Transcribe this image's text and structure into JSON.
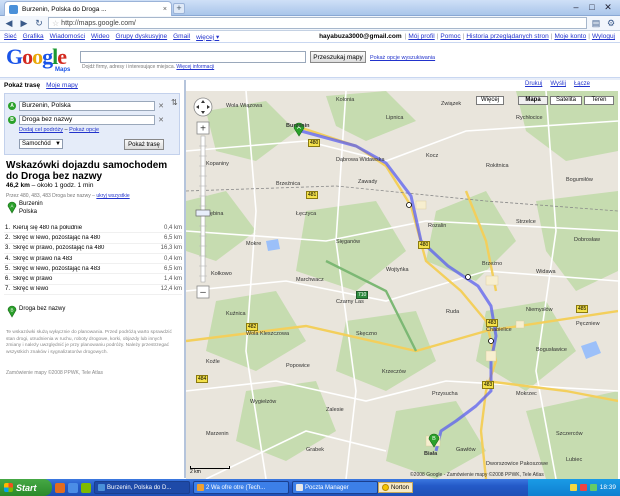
{
  "browser": {
    "tab_title": "Burzenin, Polska do Droga ...",
    "url": "http://maps.google.com/"
  },
  "gbar": {
    "links": [
      "Sieć",
      "Grafika",
      "Wiadomości",
      "Wideo",
      "Grupy dyskusyjne",
      "Gmail",
      "więcej ▾"
    ],
    "user": "hayabuza3000@gmail.com",
    "right_links": [
      "Mój profil",
      "Pomoc",
      "Historia przeglądanych stron",
      "Moje konto",
      "Wyloguj"
    ]
  },
  "logo": {
    "sub": "Maps"
  },
  "search": {
    "hint_prefix": "Dojdź firmy, adresy i interesujące miejsca.",
    "hint_link": "Więcej informacji",
    "button": "Przeszukaj mapy",
    "options": "Pokaż opcje wyszukiwania"
  },
  "map_links": [
    "Drukuj",
    "Wyślij",
    "Łącze"
  ],
  "panel": {
    "tab_active": "Pokaż trasę",
    "tab_other": "Moje mapy",
    "from": "Burzenin, Polska",
    "to": "Droga bez nazwy",
    "add_dest": "Dodaj cel podróży",
    "options": "Pokaż opcje",
    "mode": "Samochód",
    "route_button": "Pokaż trasę",
    "title": "Wskazówki dojazdu samochodem do Droga bez nazwy",
    "summary_dist": "46,2 km",
    "summary_time": " – około 1 godz. 1 min",
    "summary_link": "ukryj wszystkie",
    "route_note": "Przez 480, 483, 483 Droga bez nazwy –",
    "route_note_link": "ukryj wszystkie",
    "start_name": "Burzenin",
    "start_sub": "Polska",
    "steps": [
      {
        "n": "1.",
        "text": "Kieruj się 480 na południe",
        "dist": "0,4 km"
      },
      {
        "n": "2.",
        "text": "Skręć w lewo, pozostając na 480",
        "dist": "6,5 km"
      },
      {
        "n": "3.",
        "text": "Skręć w prawo, pozostając na 480",
        "dist": "16,3 km"
      },
      {
        "n": "4.",
        "text": "Skręć w prawo na 483",
        "dist": "0,4 km"
      },
      {
        "n": "5.",
        "text": "Skręć w lewo, pozostając na 483",
        "dist": "6,5 km"
      },
      {
        "n": "6.",
        "text": "Skręć w prawo",
        "dist": "1,4 km"
      },
      {
        "n": "7.",
        "text": "Skręć w lewo",
        "dist": "12,4 km"
      }
    ],
    "end_name": "Droga bez nazwy",
    "disclaimer": "Te wskazówki służą wyłącznie do planowania. Przed podróżą warto sprawdzić stan drogi, utrudnienia w ruchu, roboty drogowe, korki, objazdy lub innych zmiany i należy uwzględnić je przy planowaniu podróży. Należy przestrzegać wszystkich znaków i sygnalizatorów drogowych.",
    "copyright": "Zamówienie mapy ©2008 PPWK, Tele Atlas"
  },
  "map": {
    "buttons": [
      "Więcej",
      "Mapa",
      "Satelita",
      "Teren"
    ],
    "active_button": "Mapa",
    "copyright": "©2008 Google - Zamówienie mapy ©2008 PPWK, Tele Atlas",
    "scale": "2 km",
    "places": [
      "Wola Wiązowa",
      "Kolonia",
      "Związek",
      "Lipnica",
      "Rychłocice",
      "Dąbrowa Widawska",
      "Kopaniny",
      "Brzeźnica",
      "Zawady",
      "Kocz",
      "Rokitnica",
      "Bogumiłów",
      "Dębina",
      "Łęczyca",
      "Rozalin",
      "Strzelce",
      "Dobrosław",
      "Mokre",
      "Sięganów",
      "Kołkowo",
      "Marchwacz",
      "Wojtyńka",
      "Brzeżno",
      "Widawa",
      "Burzenin",
      "Kuźnica",
      "Czarny Las",
      "Biała",
      "Wola Kleszczowa",
      "Skęczno",
      "Ruda",
      "Niemysłów",
      "Pęczniew",
      "Koźle",
      "Popowice",
      "Krzeczów",
      "Chabielice",
      "Bogusławice",
      "Wygiełzów",
      "Zalesie",
      "Przysucha",
      "Mokrzec",
      "Dworszowice Pakoszowe",
      "Gawłów",
      "Marzenin",
      "Szczerców",
      "Grabek",
      "Lubiec"
    ],
    "roads": [
      "480",
      "483",
      "481",
      "482",
      "710",
      "485",
      "484"
    ]
  },
  "taskbar": {
    "start": "Start",
    "tasks": [
      "Burzenin, Polska do D...",
      "2 Wa ofre otre (Tech...",
      "Poczta Manager"
    ],
    "norton": "Norton",
    "clock": "18:39"
  }
}
